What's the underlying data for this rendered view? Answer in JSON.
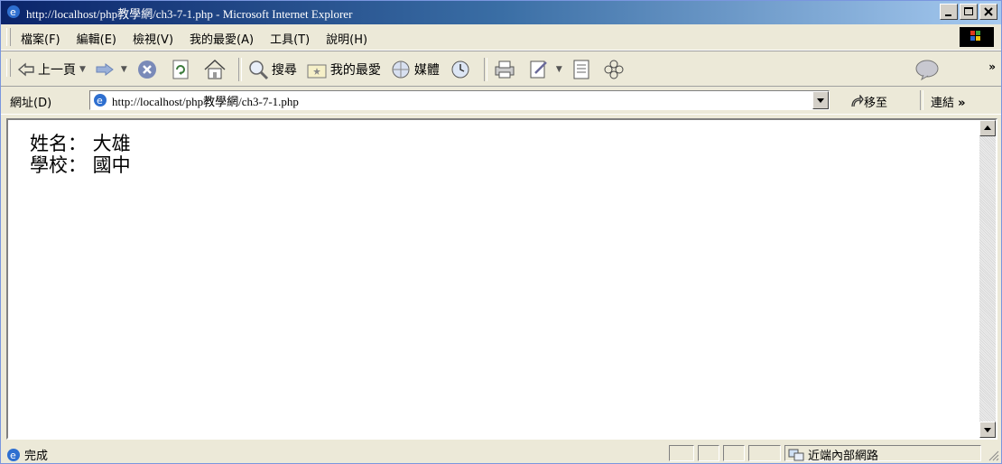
{
  "window": {
    "title": "http://localhost/php教學網/ch3-7-1.php - Microsoft Internet Explorer"
  },
  "menu": {
    "items": [
      "檔案(F)",
      "編輯(E)",
      "檢視(V)",
      "我的最愛(A)",
      "工具(T)",
      "說明(H)"
    ]
  },
  "toolbar": {
    "back_label": "上一頁",
    "search_label": "搜尋",
    "favorites_label": "我的最愛",
    "media_label": "媒體"
  },
  "address": {
    "label": "網址(D)",
    "url": "http://localhost/php教學網/ch3-7-1.php",
    "go_label": "移至",
    "links_label": "連結"
  },
  "content": {
    "lines": [
      "姓名：  大雄",
      "學校：  國中"
    ]
  },
  "status": {
    "text": "完成",
    "zone": "近端內部網路"
  }
}
